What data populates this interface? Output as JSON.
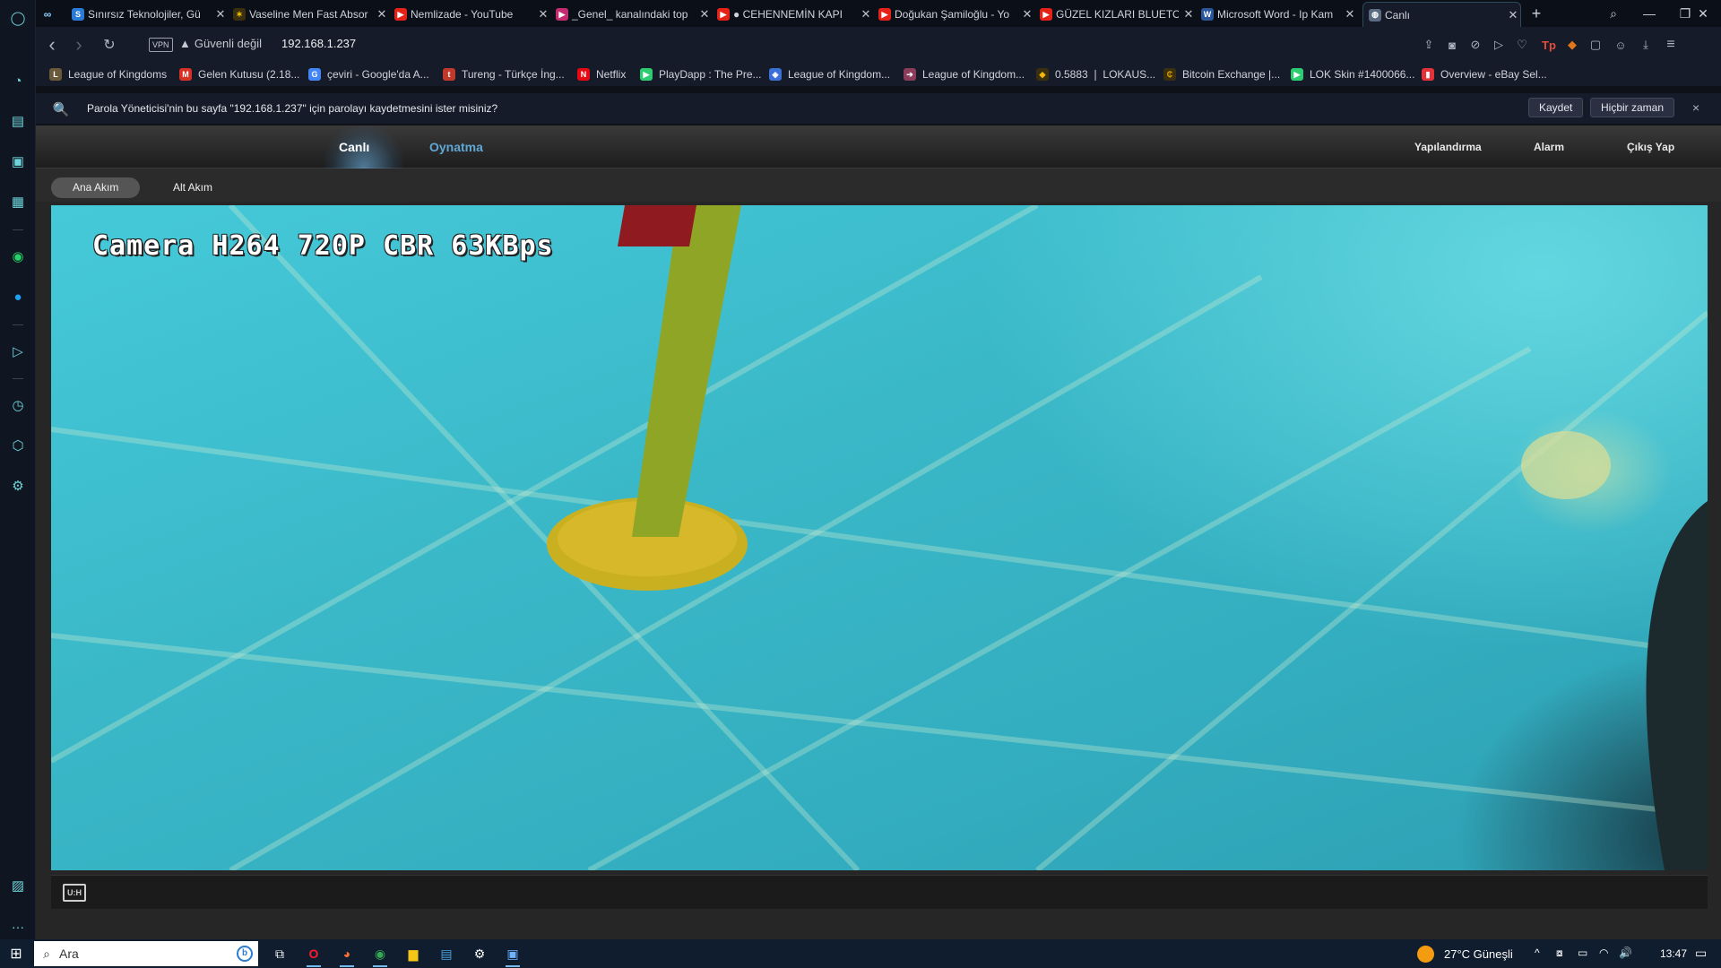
{
  "colors": {
    "accent": "#5fa8d6",
    "tab_active_border": "#2c4a5a",
    "video_bg": "#3ab8c8",
    "save_button_bg": "#2a2f42"
  },
  "sidebar": {
    "icons": [
      "opera-logo-icon",
      "speed-dial-icon",
      "shopping-icon",
      "twitch-icon",
      "tab-islands-icon",
      "whatsapp-icon",
      "twitter-icon",
      "player-icon",
      "history-icon",
      "extensions-icon",
      "settings-icon",
      "image-gallery-icon",
      "more-icon"
    ]
  },
  "tabs": [
    {
      "title": "Sınırsız Teknolojiler, Gü",
      "favicon": "S",
      "favicon_color": "#2a7ad8"
    },
    {
      "title": "Vaseline Men Fast Absor",
      "favicon": "✶",
      "favicon_color": "#f4c400"
    },
    {
      "title": "Nemlizade - YouTube",
      "favicon": "▶",
      "favicon_color": "#e62117"
    },
    {
      "title": "_Genel_ kanalındaki top",
      "favicon": "▶",
      "favicon_color": "#c42b6f"
    },
    {
      "title": "● CEHENNEMİN KAPI",
      "favicon": "▶",
      "favicon_color": "#e62117"
    },
    {
      "title": "Doğukan Şamiloğlu - Yo",
      "favicon": "▶",
      "favicon_color": "#e62117"
    },
    {
      "title": "GÜZEL KIZLARI BLUETO",
      "favicon": "▶",
      "favicon_color": "#e62117"
    },
    {
      "title": "Microsoft Word - Ip Kam",
      "favicon": "W",
      "favicon_color": "#2b579a"
    },
    {
      "title": "Canlı",
      "favicon": "◍",
      "favicon_color": "#5a6a80"
    }
  ],
  "tab_close_glyph": "✕",
  "new_tab_glyph": "+",
  "window": {
    "search": "⌕",
    "minimize": "—",
    "restore": "❐",
    "close": "✕"
  },
  "address": {
    "back": "‹",
    "forward": "›",
    "reload": "↻",
    "vpn": "VPN",
    "security_label": "Güvenli değil",
    "security_icon": "▲",
    "url": "192.168.1.237"
  },
  "toolbar_icons": [
    "share-icon",
    "camera-icon",
    "adblock-icon",
    "send-icon",
    "heart-icon",
    "tp-extension-icon",
    "metamask-icon",
    "box-icon",
    "account-icon",
    "download-icon",
    "menu-icon"
  ],
  "toolbar_glyphs": [
    "⇪",
    "◙",
    "⊘",
    "▷",
    "♡",
    "Tp",
    "◆",
    "▢",
    "☺",
    "⤓",
    "≡"
  ],
  "bookmarks": [
    {
      "label": "League of Kingdoms",
      "icon": "L",
      "color": "#6a5a3a"
    },
    {
      "label": "Gelen Kutusu (2.18...",
      "icon": "M",
      "color": "#d93025"
    },
    {
      "label": "çeviri - Google'da A...",
      "icon": "G",
      "color": "#4285f4"
    },
    {
      "label": "Tureng - Türkçe İng...",
      "icon": "t",
      "color": "#c0392b"
    },
    {
      "label": "Netflix",
      "icon": "N",
      "color": "#e50914"
    },
    {
      "label": "PlayDapp : The Pre...",
      "icon": "▶",
      "color": "#2ecc71"
    },
    {
      "label": "League of Kingdom...",
      "icon": "◈",
      "color": "#3b6fd6"
    },
    {
      "label": "League of Kingdom...",
      "icon": "➔",
      "color": "#8a3c5a"
    },
    {
      "label": "0.5883 ❘ LOKAUS...",
      "icon": "◆",
      "color": "#c9a227"
    },
    {
      "label": "Bitcoin Exchange |...",
      "icon": "₵",
      "color": "#e0a100"
    },
    {
      "label": "LOK Skin #1400066...",
      "icon": "▶",
      "color": "#2ecc71"
    },
    {
      "label": "Overview - eBay Sel...",
      "icon": "▮",
      "color": "#e53238"
    }
  ],
  "password_bar": {
    "message": "Parola Yöneticisi'nin bu sayfa \"192.168.1.237\" için parolayı kaydetmesini ister misiniz?",
    "save_label": "Kaydet",
    "never_label": "Hiçbir zaman",
    "close": "×",
    "icon": "🔍"
  },
  "app": {
    "nav_tabs": [
      "Canlı",
      "Oynatma"
    ],
    "active_tab": "Canlı",
    "nav_right": [
      "Yapılandırma",
      "Alarm",
      "Çıkış Yap"
    ],
    "streams": [
      "Ana Akım",
      "Alt Akım"
    ],
    "active_stream": "Ana Akım",
    "osd_text": "Camera H264 720P CBR 63KBps",
    "fullscreen_label": "U:H"
  },
  "taskbar": {
    "start": "⊞",
    "search_placeholder": "Ara",
    "search_icon": "⌕",
    "bing": "b",
    "apps": [
      "task-view-icon",
      "opera-icon",
      "firefox-icon",
      "chrome-icon",
      "file-explorer-icon",
      "store-icon",
      "settings-icon",
      "network-app-icon"
    ],
    "app_glyphs": [
      "⧉",
      "O",
      "◕",
      "◉",
      "▆",
      "▤",
      "⚙",
      "▣"
    ],
    "weather": "27°C  Güneşli",
    "tray": [
      "^",
      "⧇",
      "▭",
      "◠",
      "🔊"
    ],
    "time": "13:47",
    "notification": "▭"
  }
}
